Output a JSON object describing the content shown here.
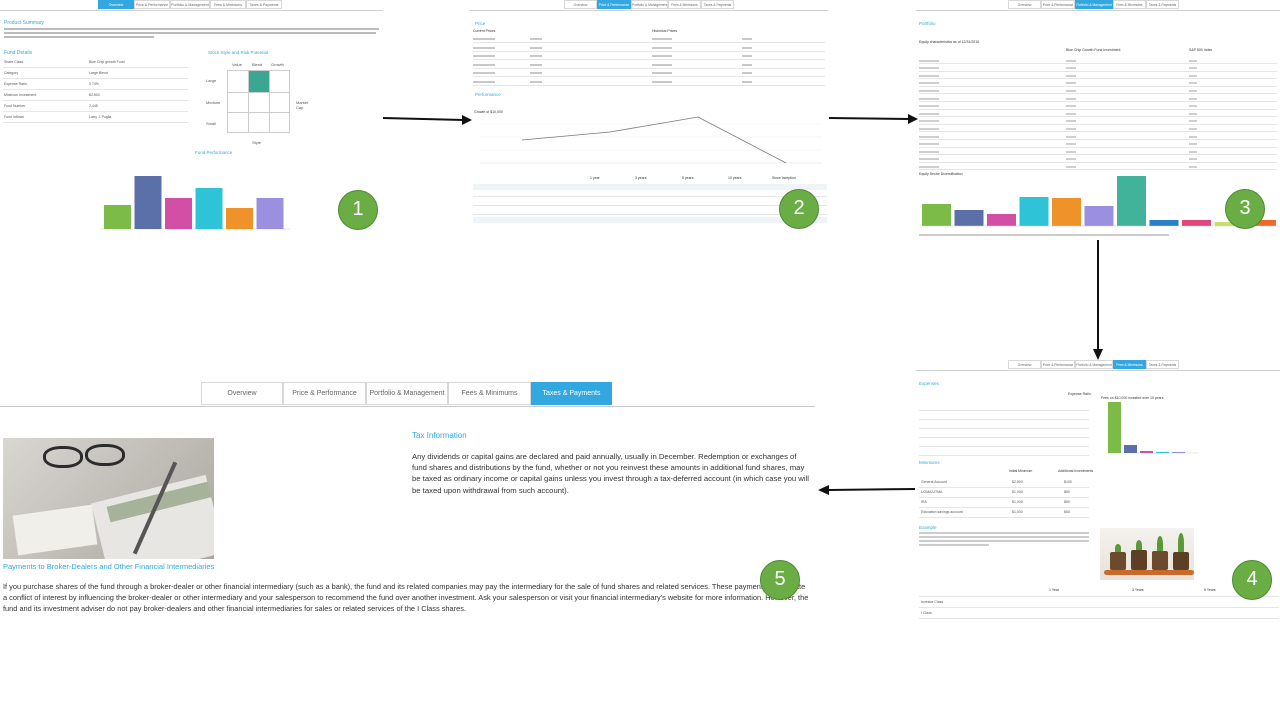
{
  "tabs": [
    "Overview",
    "Price & Performance",
    "Portfolio & Management",
    "Fees & Minimums",
    "Taxes & Payments"
  ],
  "step_numbers": [
    "1",
    "2",
    "3",
    "4",
    "5"
  ],
  "colors": {
    "accent": "#33a8e0",
    "step_circle": "#6aad45",
    "bar_palette": [
      "#7dbb48",
      "#5b6fa8",
      "#d24fa5",
      "#2ec3d6",
      "#f0922a",
      "#9b8fe0",
      "#41b39a"
    ]
  },
  "panel1": {
    "product_summary": "Product Summary",
    "fund_details": "Fund Details",
    "style_box_title": "Stock Style and Risk Potential",
    "fund_performance": "Fund Performance",
    "details": [
      {
        "label": "Share Class",
        "value": "Blue Chip growth Fund"
      },
      {
        "label": "Category",
        "value": "Large Blend"
      },
      {
        "label": "Expense Ratio",
        "value": "0.74%"
      },
      {
        "label": "Minimum Investment",
        "value": "$2,500"
      },
      {
        "label": "Fund Number",
        "value": "2,445"
      },
      {
        "label": "Fund Inflows",
        "value": "Larry J. Puglia"
      }
    ],
    "style_cols": [
      "Value",
      "Blend",
      "Growth"
    ],
    "style_rows": [
      "Large",
      "Medium",
      "Small"
    ],
    "style_axis": "Style",
    "market_cap": "Market Cap"
  },
  "panel2": {
    "price": "Price",
    "current_prices": "Current Prices",
    "historical_prices": "Historical Prices",
    "performance": "Performance",
    "growth_label": "Growth of $10,000",
    "perf_cols": [
      "1 year",
      "3 years",
      "5 years",
      "10 years",
      "Since Inception"
    ]
  },
  "panel3": {
    "portfolio": "Portfolio",
    "equity_char": "Equity characteristics as of 12/31/2016",
    "col_fund": "Blue Chip Growth Fund Investment",
    "col_index": "S&P 500 Index",
    "sector_title": "Equity Sector Diversification"
  },
  "panel4": {
    "expenses": "Expenses",
    "expense_ratio": "Expense Ratio",
    "chart_title": "Fees on $10,000 invested over 10 years",
    "minimums": "Minimums",
    "min_cols": [
      "Initial Minimum",
      "Additional Investments"
    ],
    "min_rows": [
      {
        "label": "General Account",
        "initial": "$2,500",
        "additional": "$100"
      },
      {
        "label": "UGMA/UTMA",
        "initial": "$1,000",
        "additional": "$50"
      },
      {
        "label": "IRA",
        "initial": "$1,000",
        "additional": "$50"
      },
      {
        "label": "Education savings account",
        "initial": "$1,000",
        "additional": "$50"
      }
    ],
    "example": "Example",
    "year_cols": [
      "1 Year",
      "3 Years",
      "5 Years"
    ],
    "classes": [
      "Investor Class",
      "I Class"
    ]
  },
  "panel5": {
    "tax_info_title": "Tax Information",
    "tax_info_text": "Any dividends or capital gains are declared and paid annually, usually in December. Redemption or exchanges of fund shares and distributions by the fund, whether or not you reinvest these amounts in additional fund shares, may be taxed as ordinary income or capital gains unless you invest through a tax-deferred account (in which case you will be taxed upon withdrawal from such account).",
    "payments_title": "Payments to Broker-Dealers and Other Financial Intermediaries",
    "payments_text": "If you purchase shares of the fund through a broker-dealer or other financial intermediary (such as a bank), the fund and its related companies may pay the intermediary for the sale of fund shares and related services. These payments may create a conflict of interest by influencing the broker-dealer or other intermediary and your salesperson to recommend the fund over another investment. Ask your salesperson or visit your financial intermediary's website for more information. However, the fund and its investment adviser do not pay broker-dealers and other financial intermediaries for sales or related services of the I Class shares."
  }
}
